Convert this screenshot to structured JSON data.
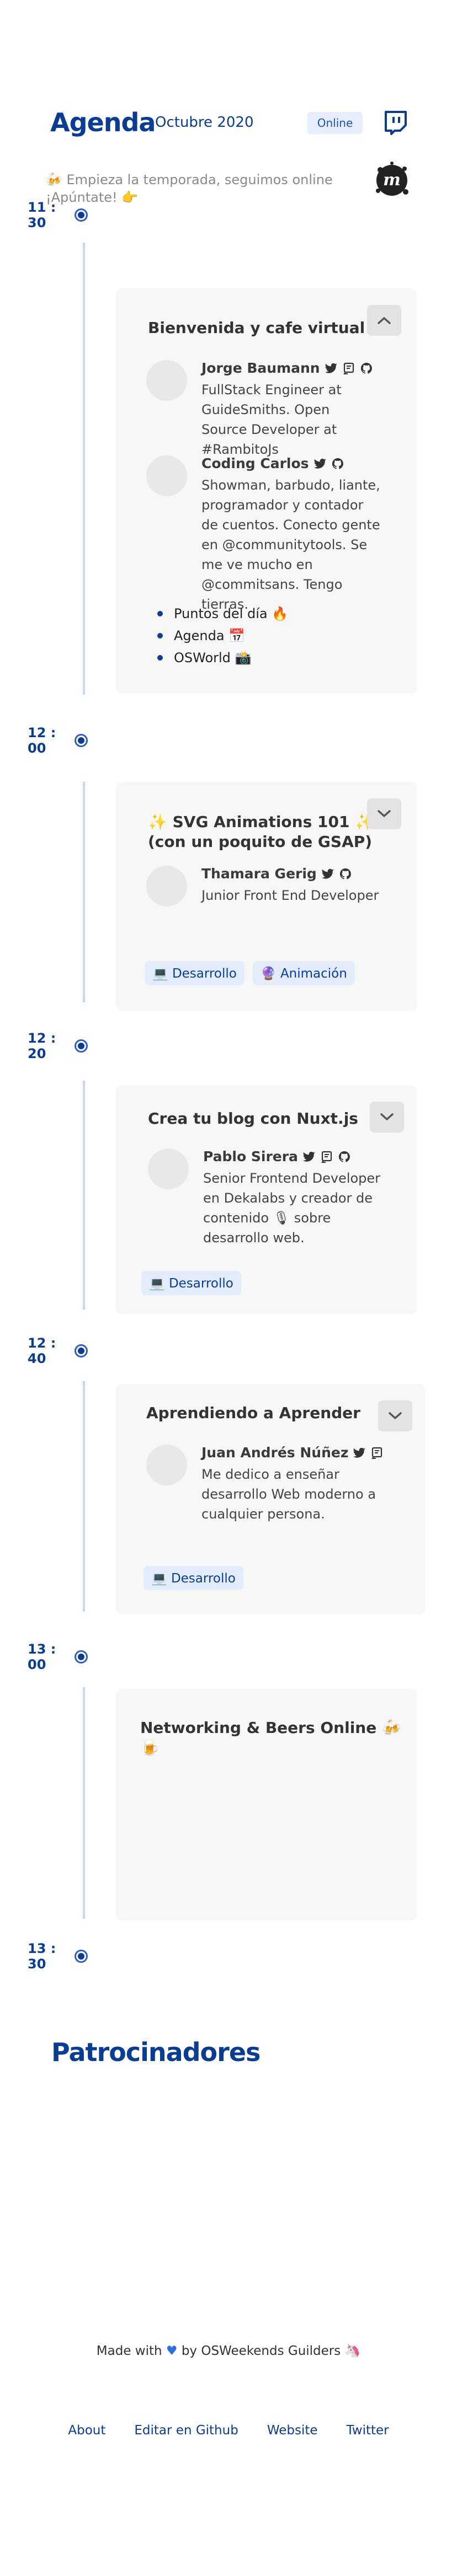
{
  "header": {
    "title": "Agenda",
    "subtitle": "Octubre 2020",
    "badge": "Online",
    "twitch_icon": "twitch-icon"
  },
  "intro": {
    "line1": "🍻 Empieza la temporada, seguimos online",
    "line2": "¡Apúntate! 👉",
    "logo_icon": "meetup-icon"
  },
  "colors": {
    "brand": "#0a3d91",
    "tag_bg": "#e3ecfb",
    "card_bg": "#f7f7f7"
  },
  "times": [
    "11 : 30",
    "12 : 00",
    "12 : 20",
    "12 : 40",
    "13 : 00",
    "13 : 30"
  ],
  "talks": [
    {
      "title": "Bienvenida y cafe virtual ☕",
      "expanded": true,
      "speakers": [
        {
          "name": "Jorge Baumann",
          "bio": "FullStack Engineer at GuideSmiths. Open Source Developer at #RambitoJs"
        },
        {
          "name": "Coding Carlos",
          "bio": "Showman, barbudo, liante, programador y contador de cuentos. Conecto gente en @communitytools. Se me ve mucho en @commitsans. Tengo tierras."
        }
      ],
      "points": [
        "Puntos del día 🔥",
        "Agenda 📅",
        "OSWorld 📸"
      ]
    },
    {
      "title_line1": "✨ SVG Animations 101 ✨",
      "title_line2": "(con un poquito de GSAP)",
      "expanded": false,
      "speakers": [
        {
          "name": "Thamara Gerig",
          "bio": "Junior Front End Developer"
        }
      ],
      "tags": [
        "💻 Desarrollo",
        "🔮 Animación"
      ]
    },
    {
      "title": "Crea tu blog con Nuxt.js",
      "expanded": false,
      "speakers": [
        {
          "name": "Pablo Sirera",
          "bio": "Senior Frontend Developer en Dekalabs y creador de contenido 🎙 sobre desarrollo web."
        }
      ],
      "tags": [
        "💻 Desarrollo"
      ]
    },
    {
      "title": "Aprendiendo a Aprender",
      "expanded": false,
      "speakers": [
        {
          "name": "Juan Andrés Núñez",
          "bio": "Me dedico a enseñar desarrollo Web moderno a cualquier persona."
        }
      ],
      "tags": [
        "💻 Desarrollo"
      ]
    },
    {
      "title": "Networking & Beers Online 🍻🍺"
    }
  ],
  "sponsors": {
    "title": "Patrocinadores"
  },
  "footer": {
    "made_prefix": "Made with",
    "made_suffix": "by OSWeekends Guilders",
    "links": [
      "About",
      "Editar en Github",
      "Website",
      "Twitter"
    ]
  }
}
